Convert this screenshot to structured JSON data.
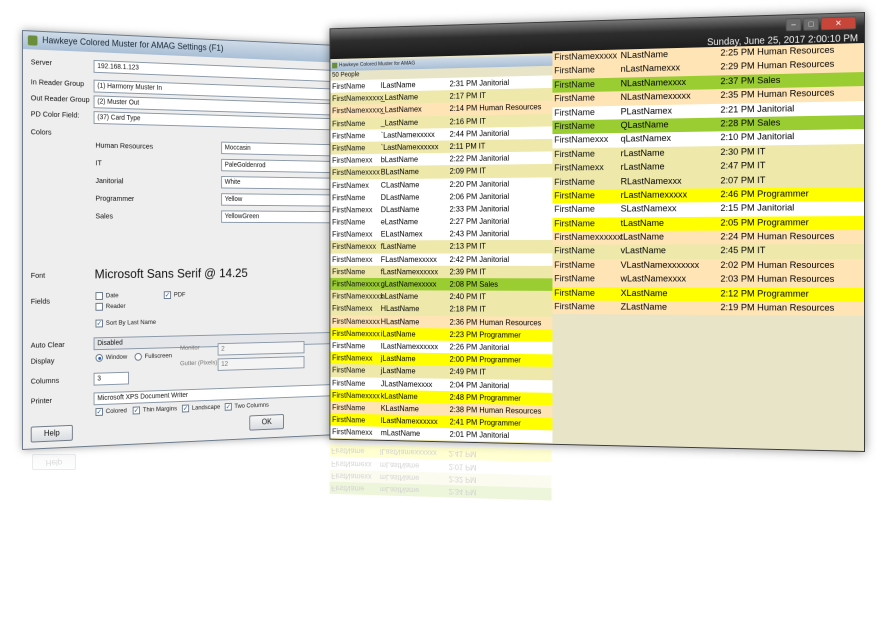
{
  "colors": {
    "human_resources": "#FFE4B5",
    "it": "#EEE8AA",
    "janitorial": "#FFFFFF",
    "programmer": "#FFFF00",
    "sales": "#9ACD32"
  },
  "settings": {
    "title": "Hawkeye Colored Muster for AMAG Settings (F1)",
    "labels": {
      "server": "Server",
      "in_reader_group": "In Reader Group",
      "out_reader_group": "Out Reader Group",
      "pd_color_field": "PD Color Field:",
      "colors": "Colors",
      "font": "Font",
      "fields": "Fields",
      "auto_clear": "Auto Clear",
      "display": "Display",
      "columns": "Columns",
      "printer": "Printer"
    },
    "server_value": "192.168.1.123",
    "in_reader_group_value": "(1) Harmony Muster In",
    "out_reader_group_value": "(2) Muster Out",
    "pd_color_field_value": "(37) Card Type",
    "color_rows": [
      {
        "group": "Human Resources",
        "color": "Moccasin"
      },
      {
        "group": "IT",
        "color": "PaleGoldenrod"
      },
      {
        "group": "Janitorial",
        "color": "White"
      },
      {
        "group": "Programmer",
        "color": "Yellow"
      },
      {
        "group": "Sales",
        "color": "YellowGreen"
      }
    ],
    "font_value": "Microsoft Sans Serif @ 14.25",
    "fields": {
      "date": "Date",
      "reader": "Reader",
      "pdf": "PDF",
      "sort_by_last_name": "Sort By Last Name"
    },
    "auto_clear_value": "Disabled",
    "display": {
      "window": "Window",
      "fullscreen": "Fullscreen",
      "monitor_label": "Monitor",
      "monitor_value": "2",
      "gutter_label": "Gutter (Pixels)",
      "gutter_value": "12"
    },
    "columns_value": "3",
    "printer_value": "Microsoft XPS Document Writer",
    "printer_options": {
      "colored": "Colored",
      "thin_margins": "Thin Margins",
      "landscape": "Landscape",
      "two_columns": "Two Columns"
    },
    "ok_label": "OK",
    "help_label": "Help"
  },
  "muster": {
    "inner_title": "Hawkeye Colored Muster for AMAG",
    "date": "Sunday, June 25, 2017 2:00:10 PM",
    "people_count": "50 People",
    "window_buttons": {
      "min": "–",
      "max": "□",
      "close": "✕"
    },
    "column1": [
      {
        "first": "FirstName",
        "last": "lLastName",
        "time": "2:31 PM",
        "group": "Janitorial"
      },
      {
        "first": "FirstNamexxxxx",
        "last": "_LastName",
        "time": "2:17 PM",
        "group": "IT"
      },
      {
        "first": "FirstNamexxxxx",
        "last": "_LastNamex",
        "time": "2:14 PM",
        "group": "Human Resources"
      },
      {
        "first": "FirstName",
        "last": "_LastName",
        "time": "2:16 PM",
        "group": "IT"
      },
      {
        "first": "FirstName",
        "last": "`LastNamexxxxx",
        "time": "2:44 PM",
        "group": "Janitorial"
      },
      {
        "first": "FirstName",
        "last": "`LastNamexxxxxx",
        "time": "2:11 PM",
        "group": "IT"
      },
      {
        "first": "FirstNamexx",
        "last": "bLastName",
        "time": "2:22 PM",
        "group": "Janitorial"
      },
      {
        "first": "FirstNamexxxx",
        "last": "BLastName",
        "time": "2:09 PM",
        "group": "IT"
      },
      {
        "first": "FirstNamex",
        "last": "CLastName",
        "time": "2:20 PM",
        "group": "Janitorial"
      },
      {
        "first": "FirstName",
        "last": "DLastName",
        "time": "2:06 PM",
        "group": "Janitorial"
      },
      {
        "first": "FirstNamexx",
        "last": "DLastName",
        "time": "2:33 PM",
        "group": "Janitorial"
      },
      {
        "first": "FirstName",
        "last": "eLastName",
        "time": "2:27 PM",
        "group": "Janitorial"
      },
      {
        "first": "FirstNamexx",
        "last": "ELastNamex",
        "time": "2:43 PM",
        "group": "Janitorial"
      },
      {
        "first": "FirstNamexxx",
        "last": "fLastName",
        "time": "2:13 PM",
        "group": "IT"
      },
      {
        "first": "FirstNamexx",
        "last": "FLastNamexxxxx",
        "time": "2:42 PM",
        "group": "Janitorial"
      },
      {
        "first": "FirstName",
        "last": "fLastNamexxxxxx",
        "time": "2:39 PM",
        "group": "IT"
      },
      {
        "first": "FirstNamexxxx",
        "last": "gLastNamexxxxx",
        "time": "2:08 PM",
        "group": "Sales"
      },
      {
        "first": "FirstNamexxxxx",
        "last": "hLastName",
        "time": "2:40 PM",
        "group": "IT"
      },
      {
        "first": "FirstNamexx",
        "last": "HLastName",
        "time": "2:18 PM",
        "group": "IT"
      },
      {
        "first": "FirstNamexxxx",
        "last": "HLastName",
        "time": "2:36 PM",
        "group": "Human Resources"
      },
      {
        "first": "FirstNamexxxx",
        "last": "iLastName",
        "time": "2:23 PM",
        "group": "Programmer"
      },
      {
        "first": "FirstName",
        "last": "ILastNamexxxxxx",
        "time": "2:26 PM",
        "group": "Janitorial"
      },
      {
        "first": "FirstNamexx",
        "last": "jLastName",
        "time": "2:00 PM",
        "group": "Programmer"
      },
      {
        "first": "FirstName",
        "last": "jLastName",
        "time": "2:49 PM",
        "group": "IT"
      },
      {
        "first": "FirstName",
        "last": "JLastNamexxxx",
        "time": "2:04 PM",
        "group": "Janitorial"
      },
      {
        "first": "FirstNamexxxx",
        "last": "kLastName",
        "time": "2:48 PM",
        "group": "Programmer"
      },
      {
        "first": "FirstName",
        "last": "KLastName",
        "time": "2:38 PM",
        "group": "Human Resources"
      },
      {
        "first": "FirstName",
        "last": "lLastNamexxxxxx",
        "time": "2:41 PM",
        "group": "Programmer"
      },
      {
        "first": "FirstNamexx",
        "last": "mLastName",
        "time": "2:01 PM",
        "group": "Janitorial"
      },
      {
        "first": "FirstNamexx",
        "last": "mLastName",
        "time": "2:32 PM",
        "group": "IT"
      },
      {
        "first": "FirstName",
        "last": "mLastName",
        "time": "2:34 PM",
        "group": "Sales"
      }
    ],
    "column2": [
      {
        "first": "FirstNamexxxxx",
        "last": "NLastName",
        "time": "2:25 PM",
        "group": "Human Resources"
      },
      {
        "first": "FirstName",
        "last": "nLastNamexxx",
        "time": "2:29 PM",
        "group": "Human Resources"
      },
      {
        "first": "FirstName",
        "last": "NLastNamexxxx",
        "time": "2:37 PM",
        "group": "Sales"
      },
      {
        "first": "FirstName",
        "last": "NLastNamexxxxx",
        "time": "2:35 PM",
        "group": "Human Resources"
      },
      {
        "first": "FirstName",
        "last": "PLastNamex",
        "time": "2:21 PM",
        "group": "Janitorial"
      },
      {
        "first": "FirstName",
        "last": "QLastName",
        "time": "2:28 PM",
        "group": "Sales"
      },
      {
        "first": "FirstNamexxx",
        "last": "qLastNamex",
        "time": "2:10 PM",
        "group": "Janitorial"
      },
      {
        "first": "FirstName",
        "last": "rLastName",
        "time": "2:30 PM",
        "group": "IT"
      },
      {
        "first": "FirstNamexx",
        "last": "rLastName",
        "time": "2:47 PM",
        "group": "IT"
      },
      {
        "first": "FirstName",
        "last": "RLastNamexxx",
        "time": "2:07 PM",
        "group": "IT"
      },
      {
        "first": "FirstName",
        "last": "rLastNamexxxxx",
        "time": "2:46 PM",
        "group": "Programmer"
      },
      {
        "first": "FirstName",
        "last": "SLastNamexx",
        "time": "2:15 PM",
        "group": "Janitorial"
      },
      {
        "first": "FirstName",
        "last": "tLastName",
        "time": "2:05 PM",
        "group": "Programmer"
      },
      {
        "first": "FirstNamexxxxxx",
        "last": "tLastName",
        "time": "2:24 PM",
        "group": "Human Resources"
      },
      {
        "first": "FirstName",
        "last": "vLastName",
        "time": "2:45 PM",
        "group": "IT"
      },
      {
        "first": "FirstName",
        "last": "VLastNamexxxxxxx",
        "time": "2:02 PM",
        "group": "Human Resources"
      },
      {
        "first": "FirstName",
        "last": "wLastNamexxxx",
        "time": "2:03 PM",
        "group": "Human Resources"
      },
      {
        "first": "FirstName",
        "last": "XLastName",
        "time": "2:12 PM",
        "group": "Programmer"
      },
      {
        "first": "FirstName",
        "last": "ZLastName",
        "time": "2:19 PM",
        "group": "Human Resources"
      }
    ]
  }
}
